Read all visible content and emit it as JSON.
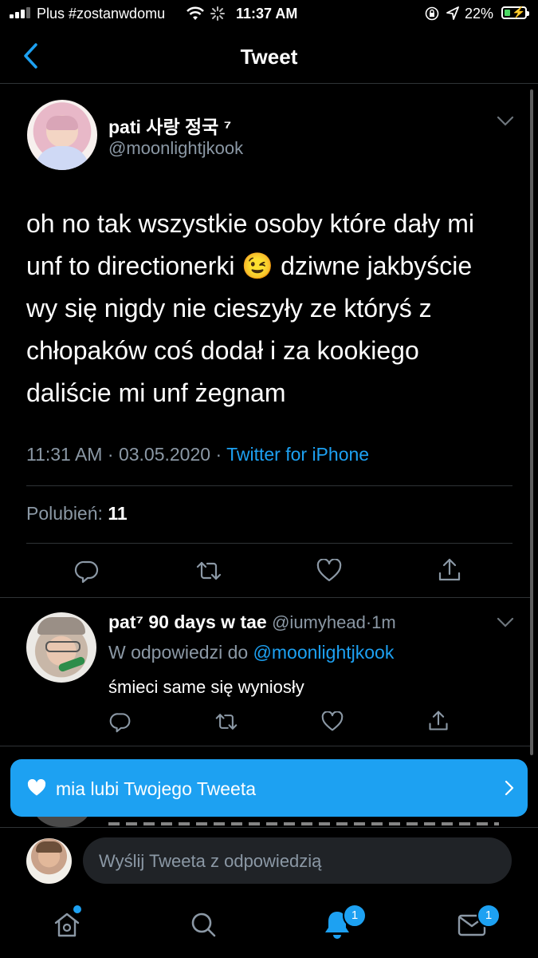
{
  "status_bar": {
    "carrier": "Plus #zostanwdomu",
    "time": "11:37 AM",
    "battery_percent": "22%",
    "battery_level": 0.22,
    "icons": [
      "signal-icon",
      "wifi-icon",
      "activity-icon",
      "orientation-lock-icon",
      "location-icon",
      "battery-icon"
    ]
  },
  "header": {
    "title": "Tweet"
  },
  "tweet": {
    "display_name": "pati 사랑 정국 ⁷",
    "handle": "@moonlightjkook",
    "text": "oh no tak wszystkie osoby które dały mi unf to directionerki 😉 dziwne jakbyście wy się nigdy nie cieszyły ze któryś z chłopaków coś dodał i za kookiego daliście mi unf żegnam",
    "time": "11:31 AM",
    "date": "03.05.2020",
    "separator": " · ",
    "source": "Twitter for iPhone",
    "likes_label": "Polubień:",
    "likes_count": "11"
  },
  "reply": {
    "display_name": "pat⁷ 90 days w tae",
    "handle": "@iumyhead",
    "age": "1m",
    "in_reply_label": "W odpowiedzi do",
    "in_reply_to": "@moonlightjkook",
    "text": "śmieci same się wyniosły"
  },
  "toast": {
    "text": "mia lubi Twojego Tweeta"
  },
  "compose": {
    "placeholder": "Wyślij Tweeta z odpowiedzią"
  },
  "tabbar": {
    "notifications_badge": "1",
    "messages_badge": "1"
  },
  "colors": {
    "accent": "#1da1f2",
    "background": "#000000",
    "secondary_text": "#8b98a5",
    "divider": "#2f3336"
  }
}
